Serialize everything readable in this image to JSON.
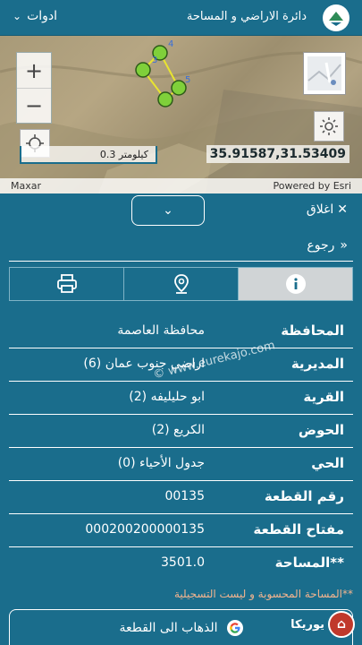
{
  "header": {
    "tools_label": "ادوات",
    "title": "دائرة الاراضي و المساحة",
    "logo_icon": "dls-logo-icon"
  },
  "map": {
    "zoom_in": "+",
    "zoom_out": "−",
    "scale": "0.3 كيلومتر",
    "coords": "35.91587,31.53409",
    "credit_left": "Maxar",
    "credit_right": "Powered by Esri",
    "parcel_labels": [
      "4",
      "3",
      "5"
    ]
  },
  "panel": {
    "close_label": "اغلاق",
    "back_label": "رجوع",
    "tabs": [
      {
        "icon": "print-icon"
      },
      {
        "icon": "location-pin-icon"
      },
      {
        "icon": "info-icon"
      }
    ]
  },
  "details": [
    {
      "label": "المحافظة",
      "value": "محافظة العاصمة"
    },
    {
      "label": "المديرية",
      "value": "اراضي جنوب عمان (6)"
    },
    {
      "label": "القرية",
      "value": "ابو حليليفه (2)"
    },
    {
      "label": "الحوض",
      "value": "الكريع (2)"
    },
    {
      "label": "الحي",
      "value": "جدول الأحياء (0)"
    },
    {
      "label": "رقم القطعة",
      "value": "00135"
    },
    {
      "label": "مفتاح القطعة",
      "value": "000200200000135"
    },
    {
      "label": "**المساحة",
      "value": "3501.0"
    }
  ],
  "note": "**المساحة المحسوبة و ليست التسجيلية",
  "goto_label": "الذهاب الى القطعة",
  "watermark": {
    "text": "© www.eurekajo.com",
    "logo_text": "يوريكا"
  },
  "colors": {
    "primary": "#1a6d8c",
    "note": "#f2b48f",
    "parcel_node": "#7fd03a",
    "parcel_line": "#e8e430"
  }
}
